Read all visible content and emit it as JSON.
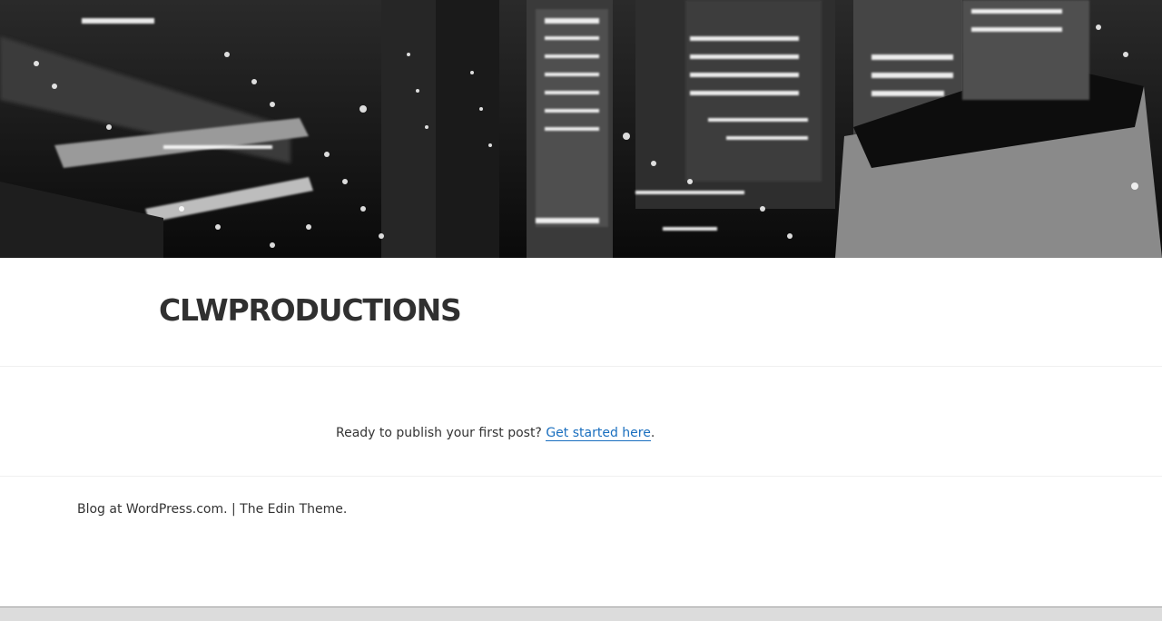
{
  "header": {
    "image_description_name": "header-image",
    "site_title": "CLWPRODUCTIONS"
  },
  "content": {
    "publish_prompt": "Ready to publish your first post?",
    "publish_link": "Get started here",
    "publish_suffix": "."
  },
  "footer": {
    "blog_link": "Blog at WordPress.com.",
    "separator": "|",
    "theme_link": "The Edin Theme."
  },
  "colors": {
    "link": "#1a6fbf",
    "text": "#333333",
    "title": "#303030"
  }
}
